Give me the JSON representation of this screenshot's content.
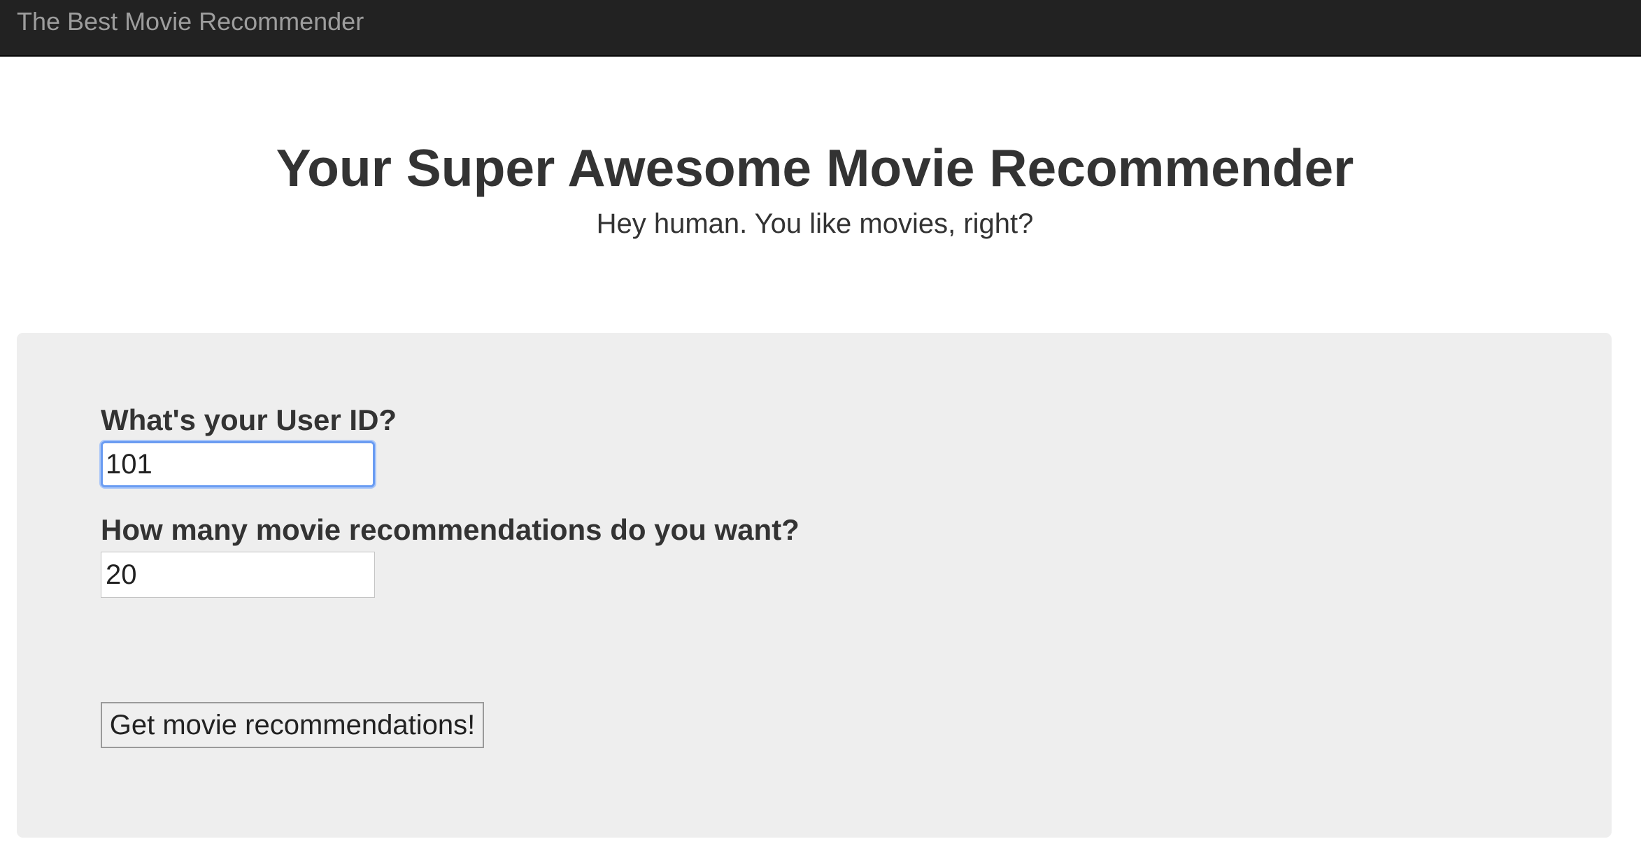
{
  "navbar": {
    "brand": "The Best Movie Recommender"
  },
  "header": {
    "title": "Your Super Awesome Movie Recommender",
    "subtitle": "Hey human. You like movies, right?"
  },
  "form": {
    "user_id_label": "What's your User ID?",
    "user_id_value": "101",
    "count_label": "How many movie recommendations do you want?",
    "count_value": "20",
    "submit_label": "Get movie recommendations!"
  },
  "colors": {
    "navbar_bg": "#222222",
    "brand_text": "#9d9d9d",
    "well_bg": "#eeeeee",
    "focus_ring": "#6a9cf2"
  }
}
